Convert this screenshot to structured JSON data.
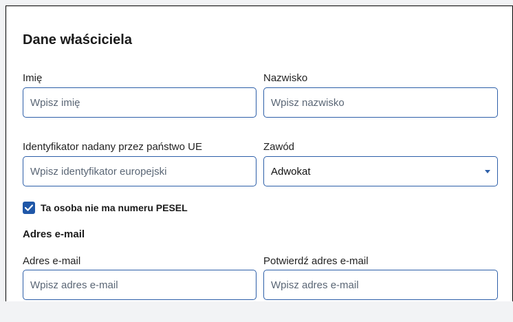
{
  "section": {
    "title": "Dane właściciela"
  },
  "fields": {
    "first_name": {
      "label": "Imię",
      "placeholder": "Wpisz imię"
    },
    "last_name": {
      "label": "Nazwisko",
      "placeholder": "Wpisz nazwisko"
    },
    "eu_id": {
      "label": "Identyfikator nadany przez państwo UE",
      "placeholder": "Wpisz identyfikator europejski"
    },
    "profession": {
      "label": "Zawód",
      "value": "Adwokat"
    }
  },
  "no_pesel": {
    "label": "Ta osoba nie ma numeru PESEL",
    "checked": true
  },
  "email": {
    "heading": "Adres e-mail",
    "address": {
      "label": "Adres e-mail",
      "placeholder": "Wpisz adres e-mail"
    },
    "confirm": {
      "label": "Potwierdź adres e-mail",
      "placeholder": "Wpisz adres e-mail"
    }
  },
  "colors": {
    "accent": "#1f57a8",
    "field_border": "#2c5ea8"
  }
}
